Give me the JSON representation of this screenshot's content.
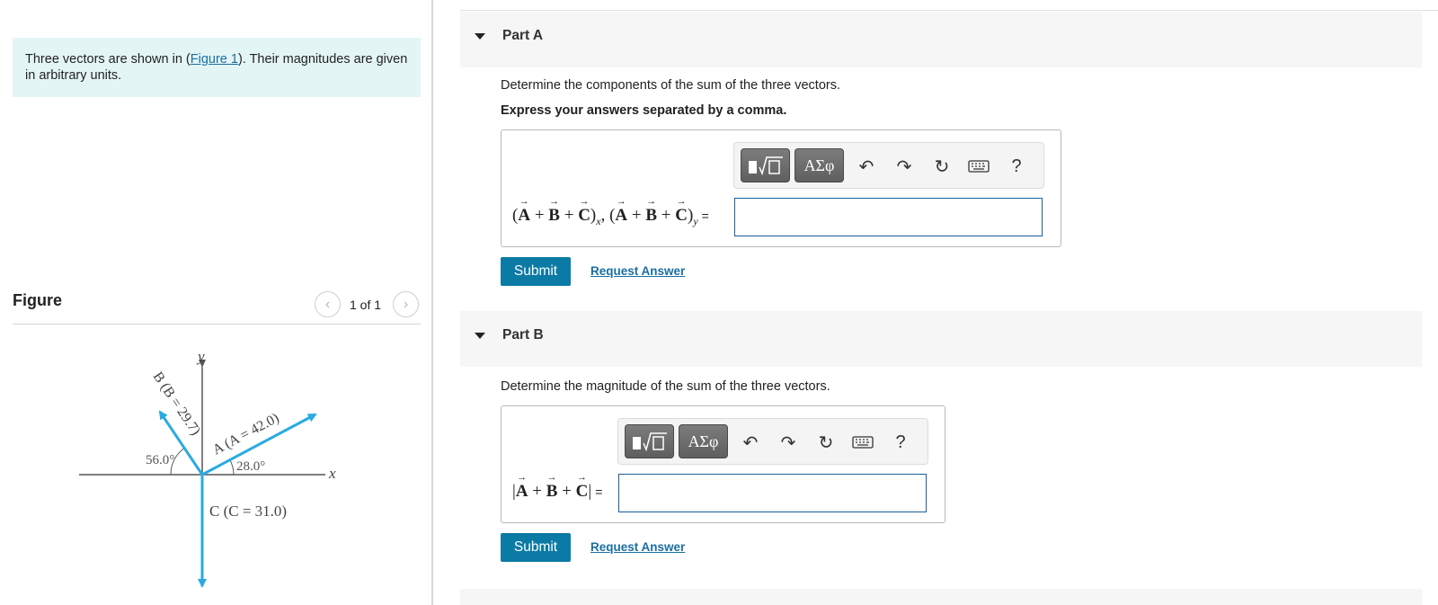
{
  "intro": {
    "text_before": "Three vectors are shown in (",
    "figure_link": "Figure 1",
    "text_after": "). Their magnitudes are given in arbitrary units."
  },
  "figure": {
    "heading": "Figure",
    "pager": "1 of 1",
    "prev_icon": "chevron-left-icon",
    "next_icon": "chevron-right-icon",
    "axis_x": "x",
    "axis_y": "y",
    "vector_a_label": "A (A = 42.0)",
    "vector_b_label": "B (B = 29.7)",
    "vector_c_label": "C (C = 31.0)",
    "angle_a": "28.0°",
    "angle_b": "56.0°",
    "vector_color": "#29abe2"
  },
  "part_a": {
    "title": "Part A",
    "instruction": "Determine the components of the sum of the three vectors.",
    "sub_instruction": "Express your answers separated by a comma.",
    "label_x_sub": "x",
    "label_y_sub": "y",
    "label_eq": "=",
    "input_value": "",
    "submit_label": "Submit",
    "request_label": "Request Answer"
  },
  "part_b": {
    "title": "Part B",
    "instruction": "Determine the magnitude of the sum of the three vectors.",
    "label_eq": "=",
    "input_value": "",
    "submit_label": "Submit",
    "request_label": "Request Answer"
  },
  "toolbar": {
    "greek_label": "ΑΣφ",
    "help_label": "?",
    "icons": [
      "templates-icon",
      "greek-symbols-icon",
      "undo-icon",
      "redo-icon",
      "reset-icon",
      "keyboard-icon",
      "help-icon"
    ]
  },
  "colors": {
    "accent": "#0b7aa5",
    "link": "#1a6fa0",
    "intro_bg": "#e4f5f6",
    "input_border": "#1a5f9a"
  }
}
